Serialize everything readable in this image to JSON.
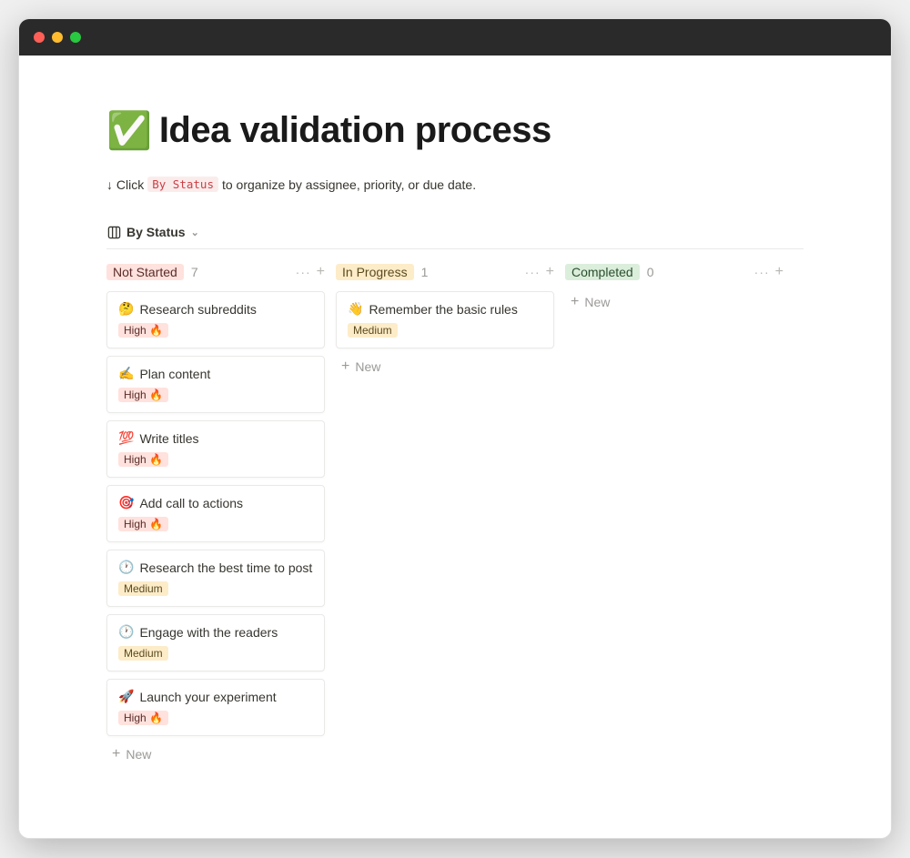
{
  "page": {
    "emoji": "✅",
    "title": "Idea validation process",
    "subtitle_prefix": "↓ Click",
    "subtitle_pill": "By Status",
    "subtitle_suffix": "to organize by assignee, priority, or due date."
  },
  "view": {
    "label": "By Status"
  },
  "columns": [
    {
      "key": "not_started",
      "label": "Not Started",
      "count": "7",
      "label_class": "label-notstarted",
      "cards": [
        {
          "emoji": "🤔",
          "title": "Research subreddits",
          "priority": "High 🔥",
          "priority_class": "priority-high"
        },
        {
          "emoji": "✍️",
          "title": "Plan content",
          "priority": "High 🔥",
          "priority_class": "priority-high"
        },
        {
          "emoji": "💯",
          "title": "Write titles",
          "priority": "High 🔥",
          "priority_class": "priority-high"
        },
        {
          "emoji": "🎯",
          "title": "Add call to actions",
          "priority": "High 🔥",
          "priority_class": "priority-high"
        },
        {
          "emoji": "🕐",
          "title": "Research the best time to post",
          "priority": "Medium",
          "priority_class": "priority-medium"
        },
        {
          "emoji": "🕐",
          "title": "Engage with the readers",
          "priority": "Medium",
          "priority_class": "priority-medium"
        },
        {
          "emoji": "🚀",
          "title": "Launch your experiment",
          "priority": "High 🔥",
          "priority_class": "priority-high"
        }
      ]
    },
    {
      "key": "in_progress",
      "label": "In Progress",
      "count": "1",
      "label_class": "label-inprogress",
      "cards": [
        {
          "emoji": "👋",
          "title": "Remember the basic rules",
          "priority": "Medium",
          "priority_class": "priority-medium"
        }
      ]
    },
    {
      "key": "completed",
      "label": "Completed",
      "count": "0",
      "label_class": "label-completed",
      "cards": []
    }
  ],
  "labels": {
    "new": "New"
  }
}
